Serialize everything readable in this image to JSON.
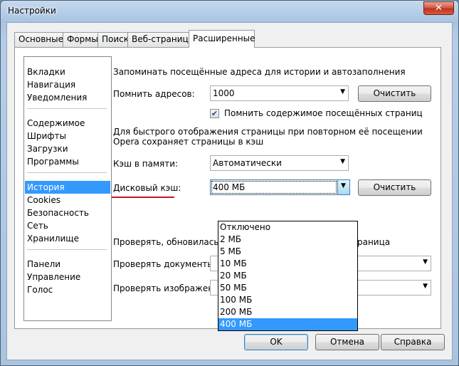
{
  "window": {
    "title": "Настройки",
    "close_label": "✕"
  },
  "tabs": [
    "Основные",
    "Формы",
    "Поиск",
    "Веб-страницы",
    "Расширенные"
  ],
  "nav": {
    "group1": [
      "Вкладки",
      "Навигация",
      "Уведомления"
    ],
    "group2": [
      "Содержимое",
      "Шрифты",
      "Загрузки",
      "Программы"
    ],
    "group3": [
      "История",
      "Cookies",
      "Безопасность",
      "Сеть",
      "Хранилище"
    ],
    "group4": [
      "Панели",
      "Управление",
      "Голос"
    ],
    "selected": "История"
  },
  "history": {
    "section_title": "Запоминать посещённые адреса для истории и автозаполнения",
    "remember_label": "Помнить адресов:",
    "remember_value": "1000",
    "clear_label": "Очистить",
    "remember_content_label": "Помнить содержимое посещённых страниц",
    "remember_content_checked": true,
    "cache_note_1": "Для быстрого отображения страницы при повторном её посещении",
    "cache_note_2": "Opera сохраняет страницы в кэш",
    "mem_cache_label": "Кэш в памяти:",
    "mem_cache_value": "Автоматически",
    "disk_cache_label": "Дисковый кэш:",
    "disk_cache_value": "400 МБ",
    "disk_clear_label": "Очистить",
    "check_text_left": "Проверять, обновилась л",
    "check_text_right": "траница",
    "check_docs_label": "Проверять документы:",
    "check_images_label": "Проверять изображения"
  },
  "disk_cache_options": [
    "Отключено",
    "2 МБ",
    "5 МБ",
    "10 МБ",
    "20 МБ",
    "50 МБ",
    "100 МБ",
    "200 МБ",
    "400 МБ"
  ],
  "footer": {
    "ok": "OK",
    "cancel": "Отмена",
    "help": "Справка"
  },
  "icons": {
    "close": "close-icon",
    "dropdown": "chevron-down-icon",
    "check": "checkmark-icon"
  },
  "colors": {
    "selection": "#3399ff",
    "accent_underline": "#c0182a"
  }
}
